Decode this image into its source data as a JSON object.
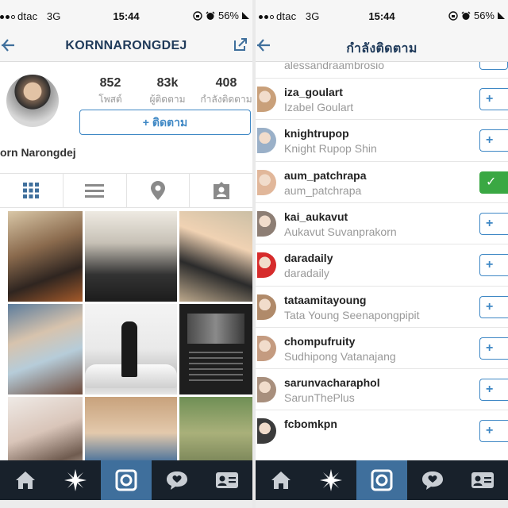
{
  "left": {
    "status": {
      "carrier": "dtac",
      "network": "3G",
      "time": "15:44",
      "battery": "56%"
    },
    "nav": {
      "title": "KORNNARONGDEJ"
    },
    "profile": {
      "posts_count": "852",
      "posts_label": "โพสต์",
      "followers_count": "83k",
      "followers_label": "ผู้ติดตาม",
      "following_count": "408",
      "following_label": "กำลังติดตาม",
      "follow_button": "+ ติดตาม",
      "full_name": "orn Narongdej"
    },
    "view_modes": [
      "grid-icon",
      "list-icon",
      "location-pin-icon",
      "tagged-person-icon"
    ],
    "photos": [
      "p1",
      "p2",
      "p3",
      "p4",
      "p5",
      "p6",
      "p7",
      "p8",
      "p9"
    ]
  },
  "right": {
    "status": {
      "carrier": "dtac",
      "network": "3G",
      "time": "15:44",
      "battery": "56%"
    },
    "nav": {
      "title": "กำลังติดตาม"
    },
    "partial_username": "alessandraambrosio",
    "following": [
      {
        "username": "iza_goulart",
        "name": "Izabel Goulart",
        "following": false,
        "color": "#c9a07a"
      },
      {
        "username": "knightrupop",
        "name": "Knight Rupop Shin",
        "following": false,
        "color": "#9ab0c8"
      },
      {
        "username": "aum_patchrapa",
        "name": "aum_patchrapa",
        "following": true,
        "color": "#e1b79a"
      },
      {
        "username": "kai_aukavut",
        "name": "Aukavut Suvanprakorn",
        "following": false,
        "color": "#8d7e74"
      },
      {
        "username": "daradaily",
        "name": "daradaily",
        "following": false,
        "color": "#d62b2b"
      },
      {
        "username": "tataamitayoung",
        "name": "Tata Young Seenapongpipit",
        "following": false,
        "color": "#b08a6a"
      },
      {
        "username": "chompufruity",
        "name": "Sudhipong Vatanajang",
        "following": false,
        "color": "#c49b80"
      },
      {
        "username": "sarunvacharaphol",
        "name": "SarunThePlus",
        "following": false,
        "color": "#a88f7d"
      },
      {
        "username": "fcbomkpn",
        "name": "",
        "following": false,
        "color": "#3b3b3b"
      }
    ],
    "follow_icon": "+",
    "following_icon": "✓"
  },
  "tabbar": [
    "home-icon",
    "explore-icon",
    "camera-icon",
    "activity-icon",
    "profile-icon"
  ],
  "colors": {
    "accent": "#3f88c5",
    "tabbar": "#18212b",
    "camera_tab": "#3f6f9c",
    "following_green": "#3aa843"
  }
}
